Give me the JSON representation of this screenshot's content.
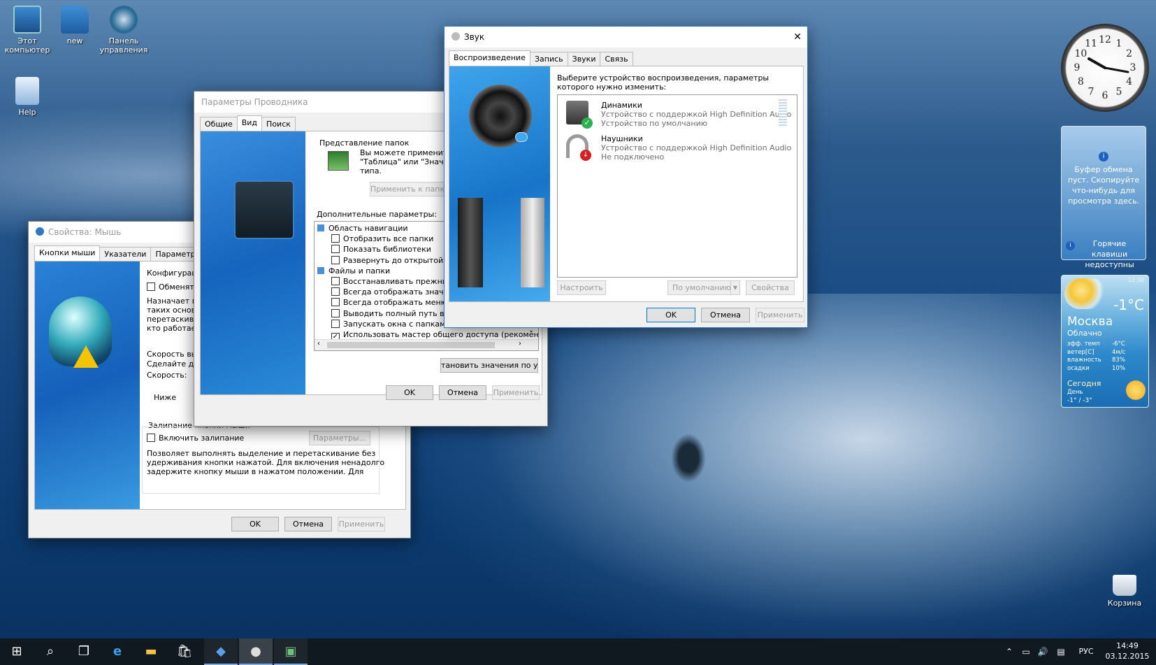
{
  "desktop": {
    "icons": [
      {
        "label": "Этот компьютер",
        "icon": "computer-icon"
      },
      {
        "label": "new",
        "icon": "user-folder-icon"
      },
      {
        "label": "Панель управления",
        "icon": "control-panel-icon"
      },
      {
        "label": "Help",
        "icon": "help-file-icon"
      },
      {
        "label": "Корзина",
        "icon": "recycle-bin-icon"
      }
    ]
  },
  "mouse_window": {
    "title": "Свойства: Мышь",
    "tabs": [
      "Кнопки мыши",
      "Указатели",
      "Параметры указа"
    ],
    "config_group": "Конфигурация",
    "swap_checkbox": "Обменять н",
    "desc_lines": [
      "Назначает пра",
      "таких основны",
      "перетаскивани",
      "кто работает с"
    ],
    "speed_group": "Скорость выпо",
    "speed_desc": "Сделайте двой",
    "speed_label": "Скорость:",
    "speed_low": "Ниже",
    "sticky_group": "Залипание кнопки мыши",
    "sticky_checkbox": "Включить залипание",
    "sticky_params": "Параметры...",
    "sticky_desc_lines": [
      "Позволяет выполнять выделение и перетаскивание без",
      "удерживания кнопки нажатой. Для включения ненадолго",
      "задержите кнопку мыши в нажатом положении. Для"
    ],
    "ok": "OK",
    "cancel": "Отмена",
    "apply": "Применить"
  },
  "explorer_window": {
    "title": "Параметры Проводника",
    "tabs": [
      "Общие",
      "Вид",
      "Поиск"
    ],
    "folders_group": "Представление папок",
    "folders_desc": [
      "Вы можете применить это",
      "\"Таблица\" или \"Значки\") к",
      "типа."
    ],
    "apply_to_folders": "Применить к папкам",
    "advanced_label": "Дополнительные параметры:",
    "tree": [
      {
        "text": "Область навигации",
        "type": "folder",
        "checked": false
      },
      {
        "text": "Отобразить все папки",
        "type": "check",
        "checked": false
      },
      {
        "text": "Показать библиотеки",
        "type": "check",
        "checked": false
      },
      {
        "text": "Развернуть до открытой папки",
        "type": "check",
        "checked": false
      },
      {
        "text": "Файлы и папки",
        "type": "folder",
        "checked": false
      },
      {
        "text": "Восстанавливать прежние окна",
        "type": "check",
        "checked": false
      },
      {
        "text": "Всегда отображать значки, а не",
        "type": "check",
        "checked": false
      },
      {
        "text": "Всегда отображать меню",
        "type": "check",
        "checked": false
      },
      {
        "text": "Выводить полный путь в заголо",
        "type": "check",
        "checked": false
      },
      {
        "text": "Запускать окна с папками в отд",
        "type": "check",
        "checked": false
      },
      {
        "text": "Использовать мастер общего доступа (рекомендуется",
        "type": "check",
        "checked": true
      }
    ],
    "restore_defaults": "тановить значения по умолч",
    "ok": "OK",
    "cancel": "Отмена",
    "apply": "Применить"
  },
  "sound_window": {
    "title": "Звук",
    "close": "✕",
    "tabs": [
      "Воспроизведение",
      "Запись",
      "Звуки",
      "Связь"
    ],
    "prompt": "Выберите устройство воспроизведения, параметры которого нужно изменить:",
    "devices": [
      {
        "name": "Динамики",
        "desc": "Устройство с поддержкой High Definition Audio",
        "status": "Устройство по умолчанию",
        "icon": "speaker-icon",
        "badge": "default-check-icon"
      },
      {
        "name": "Наушники",
        "desc": "Устройство с поддержкой High Definition Audio",
        "status": "Не подключено",
        "icon": "headphones-icon",
        "badge": "disconnected-arrow-icon"
      }
    ],
    "configure": "Настроить",
    "set_default": "По умолчанию",
    "properties": "Свойства",
    "ok": "OK",
    "cancel": "Отмена",
    "apply": "Применить"
  },
  "gadgets": {
    "clock_numbers": [
      "12",
      "1",
      "2",
      "3",
      "4",
      "5",
      "6",
      "7",
      "8",
      "9",
      "10",
      "11"
    ],
    "clipboard_text": "Буфер обмена пуст. Скопируйте что-нибудь для просмотра здесь.",
    "clipboard_hotkeys": "Горячие клавиши недоступны",
    "weather": {
      "time": "12:30",
      "temp": "-1°C",
      "city": "Москва",
      "condition": "Облачно",
      "rows": [
        [
          "эфф. темп",
          "-6°C"
        ],
        [
          "ветер[С]",
          "4м/с"
        ],
        [
          "влажность",
          "83%"
        ],
        [
          "осадки",
          "10%"
        ]
      ],
      "today": "Сегодня",
      "day": "День",
      "range": "-1° / -3°"
    }
  },
  "taskbar": {
    "lang": "РУС",
    "time": "14:49",
    "date": "03.12.2015"
  }
}
